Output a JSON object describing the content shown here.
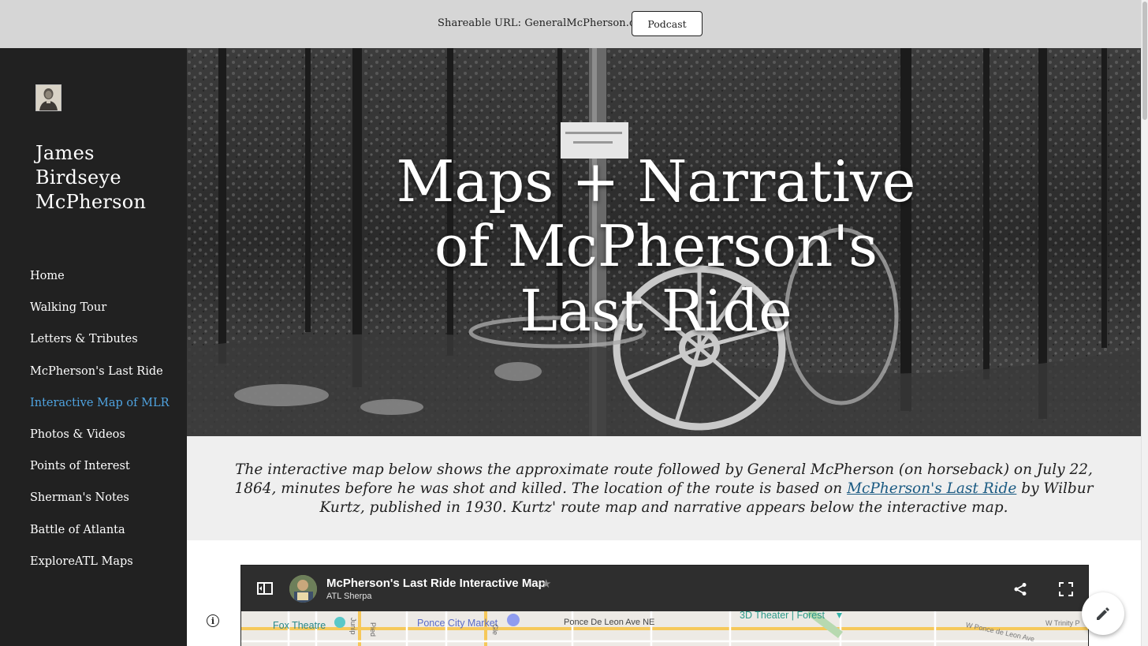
{
  "topbar": {
    "shareable_url": "Shareable URL: GeneralMcPherson.com",
    "podcast_label": "Podcast"
  },
  "sidebar": {
    "site_title": "James Birdseye McPherson",
    "avatar_icon": "portrait-photo",
    "nav_items": [
      {
        "label": "Home",
        "active": false
      },
      {
        "label": "Walking Tour",
        "active": false
      },
      {
        "label": "Letters & Tributes",
        "active": false
      },
      {
        "label": "McPherson's Last Ride",
        "active": false
      },
      {
        "label": "Interactive Map of MLR",
        "active": true
      },
      {
        "label": "Photos & Videos",
        "active": false
      },
      {
        "label": "Points of Interest",
        "active": false
      },
      {
        "label": "Sherman's Notes",
        "active": false
      },
      {
        "label": "Battle of Atlanta",
        "active": false
      },
      {
        "label": "ExploreATL Maps",
        "active": false
      }
    ],
    "active_color": "#4fa3e0"
  },
  "hero": {
    "title_lines": [
      "Maps + Narrative",
      "of McPherson's",
      "Last Ride"
    ]
  },
  "intro": {
    "text_before": "The interactive map below shows the approximate route followed by General McPherson (on horseback) on July 22, 1864, minutes before he was shot and killed. The location of the route is based on ",
    "link_text": "McPherson's Last Ride",
    "text_after": " by Wilbur Kurtz, published in 1930. Kurtz' route map and narrative appears below the interactive map."
  },
  "map_embed": {
    "title": "McPherson's Last Ride Interactive Map",
    "owner": "ATL Sherpa",
    "star_glyph": "★",
    "labels": {
      "fox_theatre": "Fox Theatre",
      "juniper": "Junip",
      "piedmont": "Pied",
      "ponce_city_market": "Ponce City Market",
      "glen": "Gle",
      "ponce_de_leon": "Ponce De Leon Ave NE",
      "theater_forest": "3D Theater | Forest",
      "w_ponce": "W Ponce de Leon Ave",
      "w_trinity": "W Trinity P"
    }
  },
  "colors": {
    "sidebar_bg": "#212121",
    "topbar_bg": "#d6d6d6",
    "intro_bg": "#efefef",
    "link": "#1a5a82"
  }
}
